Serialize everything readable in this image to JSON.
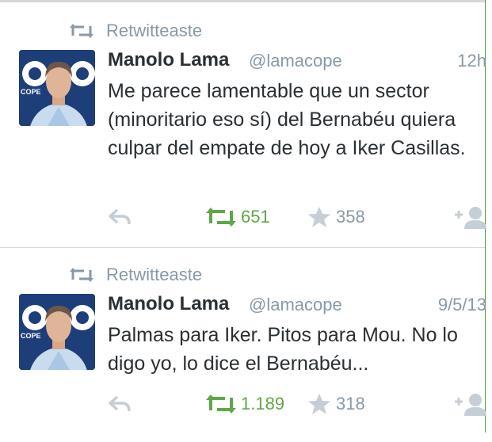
{
  "tweets": [
    {
      "retweet_label": "Retwitteaste",
      "name": "Manolo Lama",
      "handle": "@lamacope",
      "time": "12h",
      "text": "Me parece lamentable que un sector (minoritario eso sí) del Bernabéu quiera culpar del empate de hoy a Iker Casillas.",
      "retweets": "651",
      "favorites": "358",
      "avatar_logo": "COPE"
    },
    {
      "retweet_label": "Retwitteaste",
      "name": "Manolo Lama",
      "handle": "@lamacope",
      "time": "9/5/13",
      "text": "Palmas para Iker. Pitos para Mou. No lo digo yo, lo dice el Bernabéu...",
      "retweets": "1.189",
      "favorites": "318",
      "avatar_logo": "COPE"
    }
  ],
  "icons": {
    "retweeted_indicator": "retweet-icon",
    "reply": "reply-icon",
    "retweet": "retweet-icon",
    "favorite": "star-icon",
    "follow": "follow-user-icon"
  },
  "colors": {
    "retweet_active": "#5fa747",
    "muted": "#8899a6",
    "text": "#292f33"
  }
}
